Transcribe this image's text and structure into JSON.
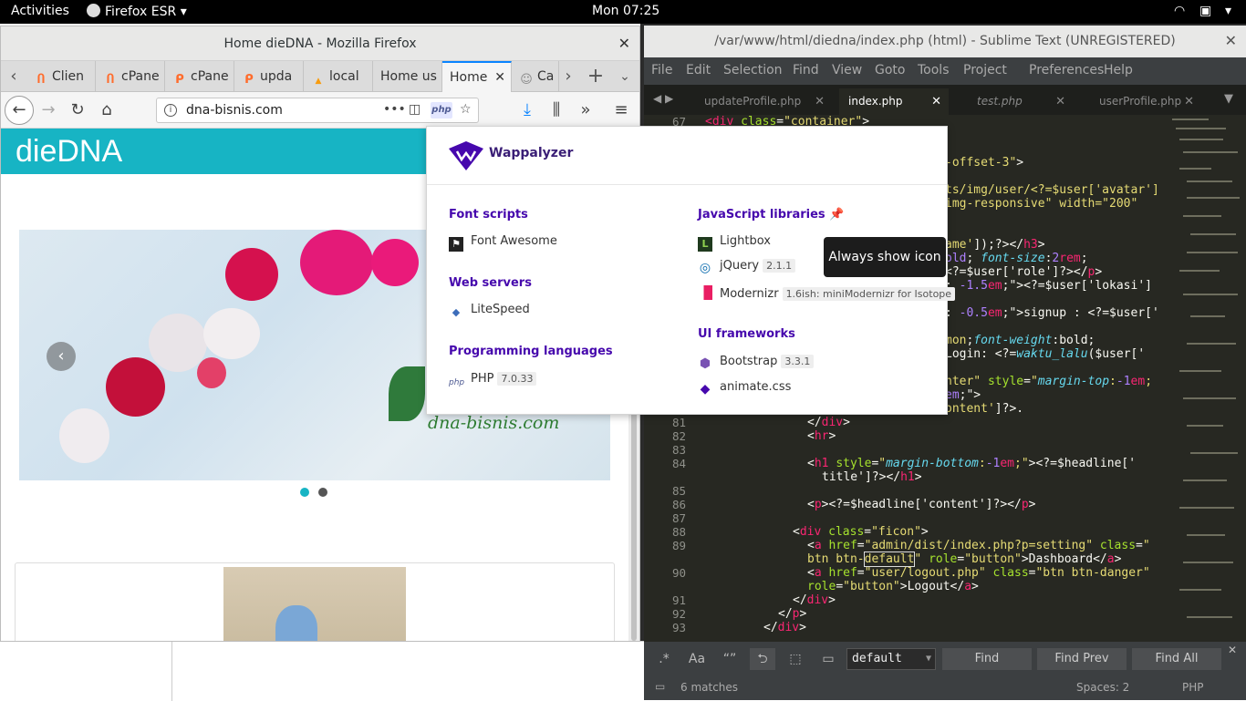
{
  "topbar": {
    "activities": "Activities",
    "app_menu": "Firefox ESR",
    "clock": "Mon 07:25"
  },
  "firefox": {
    "title": "Home dieDNA - Mozilla Firefox",
    "tabs": [
      {
        "label": "Clien",
        "favicon": "cpanel-icon"
      },
      {
        "label": "cPane",
        "favicon": "cpanel-icon"
      },
      {
        "label": "cPane",
        "favicon": "cpanel-icon"
      },
      {
        "label": "upda",
        "favicon": "cpanel-icon"
      },
      {
        "label": "local",
        "favicon": "phpmyadmin-icon"
      },
      {
        "label": "Home us",
        "favicon": ""
      },
      {
        "label": "Home",
        "favicon": "",
        "active": true
      },
      {
        "label": "Ca",
        "favicon": "user-icon"
      }
    ],
    "url": "dna-bisnis.com",
    "url_badge": "php"
  },
  "site": {
    "logo": "dieDNA",
    "watermark": "dna-bisnis.com"
  },
  "wappalyzer": {
    "brand": "Wappalyzer",
    "left_categories": [
      {
        "name": "Font scripts",
        "items": [
          {
            "name": "Font Awesome",
            "version": "",
            "icon": "font-awesome-icon"
          }
        ]
      },
      {
        "name": "Web servers",
        "items": [
          {
            "name": "LiteSpeed",
            "version": "",
            "icon": "litespeed-icon"
          }
        ]
      },
      {
        "name": "Programming languages",
        "items": [
          {
            "name": "PHP",
            "version": "7.0.33",
            "icon": "php-icon"
          }
        ]
      }
    ],
    "right_categories": [
      {
        "name": "JavaScript libraries",
        "items": [
          {
            "name": "Lightbox",
            "version": "",
            "icon": "lightbox-icon"
          },
          {
            "name": "jQuery",
            "version": "2.1.1",
            "icon": "jquery-icon"
          },
          {
            "name": "Modernizr",
            "version": "1.6ish: miniModernizr for Isotope",
            "icon": "modernizr-icon"
          }
        ]
      },
      {
        "name": "UI frameworks",
        "items": [
          {
            "name": "Bootstrap",
            "version": "3.3.1",
            "icon": "bootstrap-icon"
          },
          {
            "name": "animate.css",
            "version": "",
            "icon": "animate-css-icon"
          }
        ]
      }
    ],
    "tooltip": "Always show icon"
  },
  "sublime": {
    "title": "/var/www/html/diedna/index.php (html) - Sublime Text (UNREGISTERED)",
    "menu": [
      "File",
      "Edit",
      "Selection",
      "Find",
      "View",
      "Goto",
      "Tools",
      "Project",
      "Preferences",
      "Help"
    ],
    "tabs": [
      {
        "label": "updateProfile.php"
      },
      {
        "label": "index.php",
        "active": true
      },
      {
        "label": "test.php"
      },
      {
        "label": "userProfile.php"
      }
    ],
    "line_numbers": [
      "67",
      "",
      "",
      "",
      "",
      "",
      "",
      "",
      "",
      "",
      "",
      "",
      "",
      "",
      "81",
      "82",
      "83",
      "84",
      "",
      "85",
      "86",
      "87",
      "88",
      "89",
      "",
      "90",
      "",
      "91",
      "92",
      "93"
    ],
    "find_value": "default",
    "find_buttons": {
      "find": "Find",
      "find_prev": "Find Prev",
      "find_all": "Find All"
    },
    "status": {
      "matches": "6 matches",
      "spaces": "Spaces: 2",
      "syntax": "PHP"
    }
  },
  "colors": {
    "site_header": "#17b4c4",
    "wappalyzer": "#4608ad",
    "sublime_bg": "#272822",
    "tab_accent": "#0a84ff"
  }
}
